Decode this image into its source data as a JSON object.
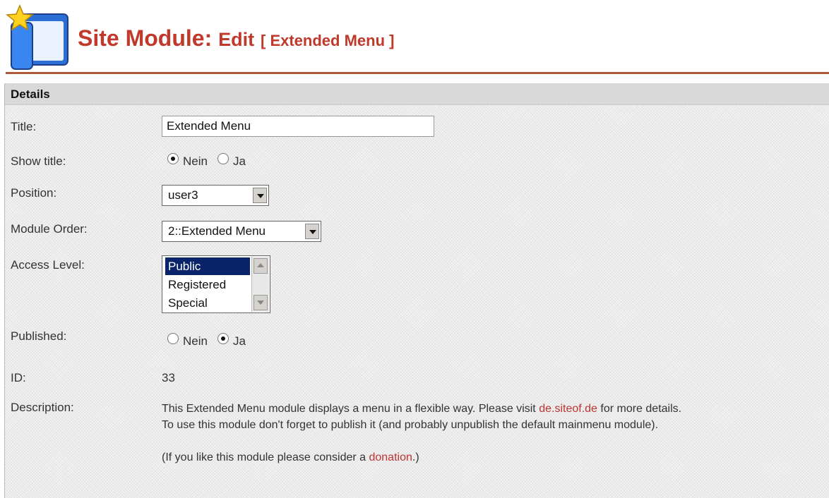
{
  "header": {
    "title_main": "Site Module:",
    "title_edit": "Edit",
    "title_bracket": "[ Extended Menu ]",
    "logo_icon": "module-window-star-icon"
  },
  "panel": {
    "heading": "Details",
    "fields": {
      "title_label": "Title:",
      "title_value": "Extended Menu",
      "show_title_label": "Show title:",
      "show_title_options": [
        "Nein",
        "Ja"
      ],
      "show_title_selected": "Nein",
      "position_label": "Position:",
      "position_value": "user3",
      "module_order_label": "Module Order:",
      "module_order_value": "2::Extended Menu",
      "access_level_label": "Access Level:",
      "access_level_options": [
        "Public",
        "Registered",
        "Special"
      ],
      "access_level_selected": "Public",
      "published_label": "Published:",
      "published_options": [
        "Nein",
        "Ja"
      ],
      "published_selected": "Ja",
      "id_label": "ID:",
      "id_value": "33",
      "description_label": "Description:"
    },
    "description": {
      "line1_pre": "This Extended Menu module displays a menu in a flexible way. Please visit ",
      "line1_link": "de.siteof.de",
      "line1_post": " for more details.",
      "line2": "To use this module don't forget to publish it (and probably unpublish the default mainmenu module).",
      "line3_pre": "(If you like this module please consider a ",
      "line3_link": "donation",
      "line3_post": ".)"
    }
  },
  "colors": {
    "title": "#c0392b",
    "rule": "#b05a3a",
    "link": "#bb3333",
    "selection": "#0a246a"
  }
}
